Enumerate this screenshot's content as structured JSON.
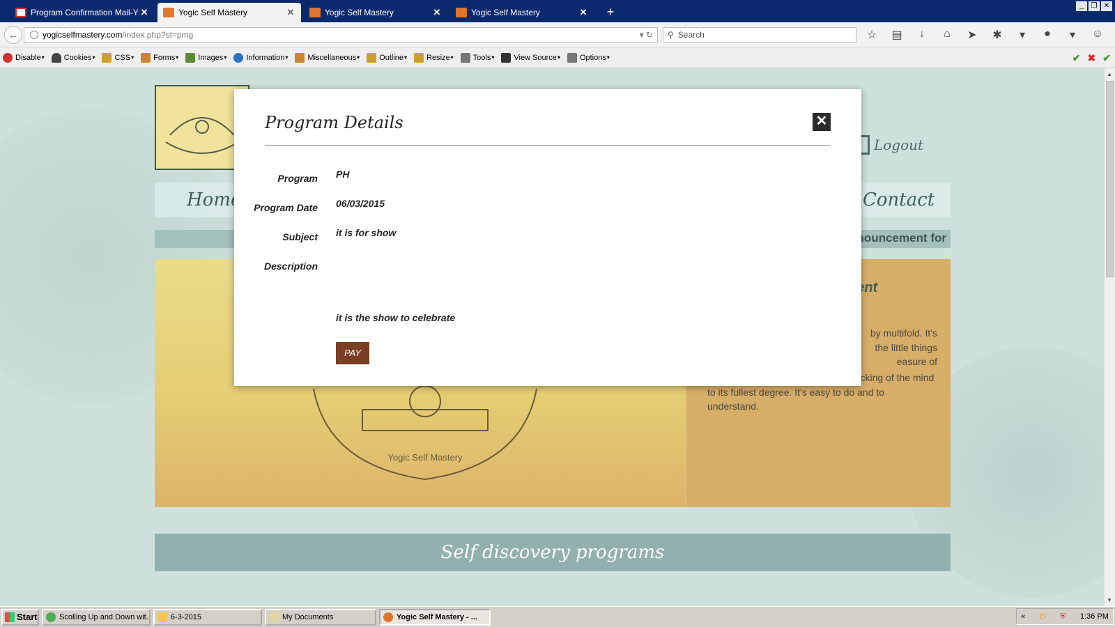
{
  "browser": {
    "tabs": [
      {
        "title": "Program Confirmation Mail-YS...",
        "active": false,
        "favicon_color": "#d93025"
      },
      {
        "title": "Yogic Self Mastery",
        "active": true,
        "favicon_color": "#e0762b"
      },
      {
        "title": "Yogic Self Mastery",
        "active": false,
        "favicon_color": "#e0762b"
      },
      {
        "title": "Yogic Self Mastery",
        "active": false,
        "favicon_color": "#e0762b"
      }
    ],
    "close_glyph": "✕",
    "new_tab_glyph": "+",
    "url_host": "yogicselfmastery.com",
    "url_path": "/index.php?st=pmg",
    "search_placeholder": "Search"
  },
  "devtoolbar": {
    "items": [
      {
        "label": "Disable",
        "icon": "disable-icon",
        "color": "#d32f2f"
      },
      {
        "label": "Cookies",
        "icon": "cookies-icon",
        "color": "#444444"
      },
      {
        "label": "CSS",
        "icon": "css-icon",
        "color": "#caa12c"
      },
      {
        "label": "Forms",
        "icon": "forms-icon",
        "color": "#c8862f"
      },
      {
        "label": "Images",
        "icon": "images-icon",
        "color": "#5a8a3a"
      },
      {
        "label": "Information",
        "icon": "information-icon",
        "color": "#2f6fc8"
      },
      {
        "label": "Miscellaneous",
        "icon": "miscellaneous-icon",
        "color": "#c8862f"
      },
      {
        "label": "Outline",
        "icon": "outline-icon",
        "color": "#caa12c"
      },
      {
        "label": "Resize",
        "icon": "resize-icon",
        "color": "#caa12c"
      },
      {
        "label": "Tools",
        "icon": "tools-icon",
        "color": "#777777"
      },
      {
        "label": "View Source",
        "icon": "view-source-icon",
        "color": "#333333"
      },
      {
        "label": "Options",
        "icon": "options-icon",
        "color": "#777777"
      }
    ]
  },
  "site": {
    "logout_label": "Logout",
    "nav_home": "Home",
    "nav_contact": "Contact",
    "announcement": "nouncement for",
    "panel_heading": "nent",
    "panel_line1": "by multifold. It's",
    "panel_line2": "the little things",
    "panel_line3": "easure of",
    "panel_body": "playful techniques, there is the unlocking of the mind to its fullest degree. It's easy to do and to understand.",
    "seal_caption": "Yogic Self Mastery",
    "section_title": "Self discovery programs"
  },
  "modal": {
    "title": "Program Details",
    "close_glyph": "✕",
    "fields": {
      "program_label": "Program",
      "program_value": "PH",
      "date_label": "Program Date",
      "date_value": "06/03/2015",
      "subject_label": "Subject",
      "subject_value": "it is for show",
      "description_label": "Description",
      "description_value": "it is the show to celebrate"
    },
    "pay_label": "PAY"
  },
  "taskbar": {
    "start_label": "Start",
    "tasks": [
      {
        "label": "Scolling Up and Down wit...",
        "active": false
      },
      {
        "label": "6-3-2015",
        "active": false
      },
      {
        "label": "My Documents",
        "active": false
      },
      {
        "label": "Yogic Self Mastery - ...",
        "active": true
      }
    ],
    "tray_chevron": "«",
    "clock": "1:36 PM"
  }
}
